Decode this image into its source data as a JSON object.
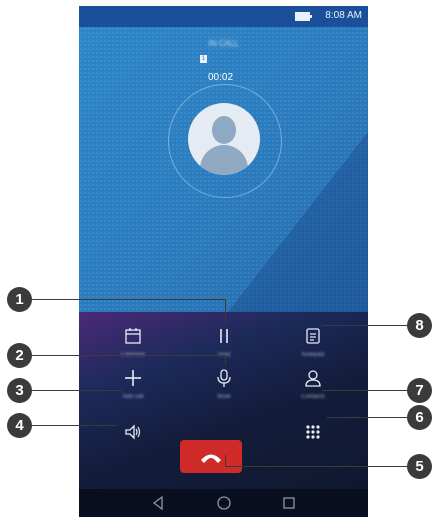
{
  "statusbar": {
    "time": "8:08 AM"
  },
  "call": {
    "state_label": "IN CALL",
    "sim_label": "1",
    "duration": "00:02"
  },
  "buttons": {
    "calendar": "Calendar",
    "hold": "Hold",
    "notepad": "Notepad",
    "mute": "Mute",
    "add_call": "Add call",
    "contacts": "Contacts",
    "speaker": "",
    "dialpad": ""
  },
  "callouts": [
    "1",
    "2",
    "3",
    "4",
    "5",
    "6",
    "7",
    "8"
  ],
  "colors": {
    "end_call": "#d12b29",
    "call_bg": "#2b7ec0",
    "callout": "#3b3b3b"
  },
  "icons": [
    "calendar-icon",
    "pause-icon",
    "notepad-icon",
    "microphone-icon",
    "plus-icon",
    "person-icon",
    "speaker-icon",
    "dialpad-icon",
    "phone-hangup-icon",
    "back-icon",
    "home-icon",
    "recents-icon"
  ]
}
